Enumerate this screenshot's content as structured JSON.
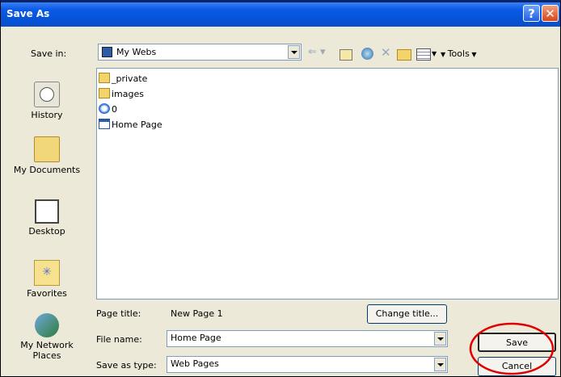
{
  "window": {
    "title": "Save As"
  },
  "toolbar": {
    "save_in_label": "Save in:",
    "save_in_value": "My Webs",
    "tools_label": "Tools"
  },
  "places": [
    {
      "label": "History",
      "icon": "history-icon"
    },
    {
      "label": "My Documents",
      "icon": "my-documents-icon"
    },
    {
      "label": "Desktop",
      "icon": "desktop-icon"
    },
    {
      "label": "Favorites",
      "icon": "favorites-icon"
    },
    {
      "label": "My Network Places",
      "icon": "network-places-icon"
    }
  ],
  "files": [
    {
      "name": "_private",
      "icon": "folder-icon"
    },
    {
      "name": "images",
      "icon": "folder-icon"
    },
    {
      "name": "0",
      "icon": "ie-page-icon"
    },
    {
      "name": "Home Page",
      "icon": "web-page-icon"
    }
  ],
  "form": {
    "page_title_label": "Page title:",
    "page_title_value": "New Page 1",
    "change_title_label": "Change title...",
    "file_name_label": "File name:",
    "file_name_value": "Home Page",
    "save_as_type_label": "Save as type:",
    "save_as_type_value": "Web Pages",
    "save_label": "Save",
    "cancel_label": "Cancel"
  },
  "colors": {
    "titlebar": "#0a5ae6",
    "highlight_circle": "#e00000",
    "dialog_bg": "#ece9d8"
  }
}
